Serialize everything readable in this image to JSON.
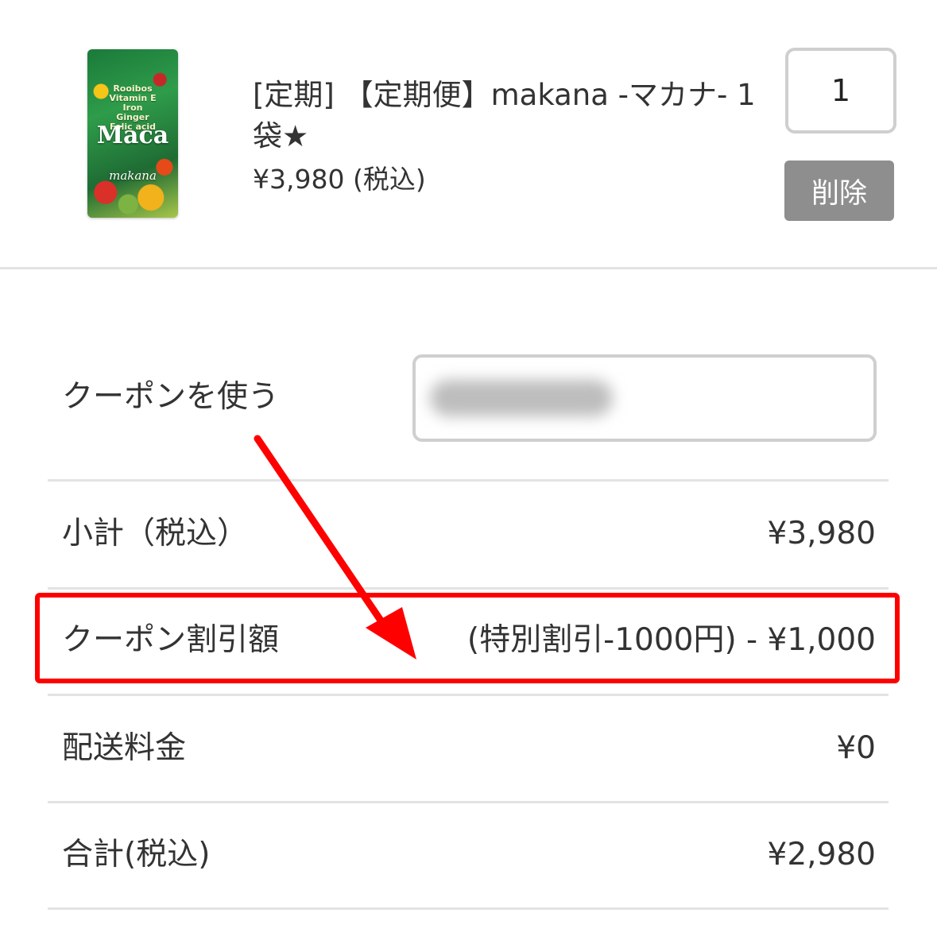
{
  "cart_item": {
    "image": {
      "pack_text": "Rooibos\nVitamin E\nIron\nGinger\nFolic acid",
      "pack_title": "Maca",
      "pack_brand": "makana"
    },
    "name": "[定期] 【定期便】makana -マカナ- 1袋★",
    "price": "¥3,980 (税込)",
    "quantity": "1",
    "delete_label": "削除"
  },
  "coupon": {
    "label": "クーポンを使う",
    "input_value": ""
  },
  "summary": {
    "subtotal": {
      "label": "小計（税込）",
      "value": "¥3,980"
    },
    "coupon_discount": {
      "label": "クーポン割引額",
      "value": "(特別割引-1000円) - ¥1,000"
    },
    "shipping": {
      "label": "配送料金",
      "value": "¥0"
    },
    "total": {
      "label": "合計(税込)",
      "value": "¥2,980"
    }
  },
  "annotation": {
    "color": "#ff0000"
  }
}
